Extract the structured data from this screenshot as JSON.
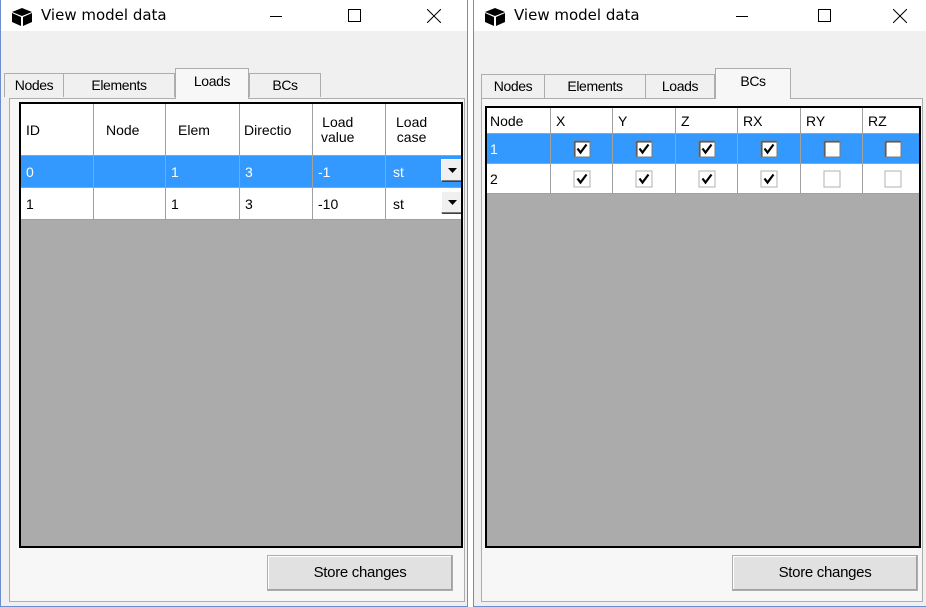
{
  "windows": [
    {
      "title": "View model data",
      "tabs": [
        "Nodes",
        "Elements",
        "Loads",
        "BCs"
      ],
      "active_tab": "Loads",
      "columns": [
        "ID",
        "Node",
        "Elem",
        "Directio",
        "Load value",
        "Load case"
      ],
      "column_lines": {
        "load_value": [
          "Load",
          "value"
        ],
        "load_case": [
          "Load",
          "case"
        ]
      },
      "rows": [
        {
          "id": "0",
          "node": "",
          "elem": "1",
          "direction": "3",
          "load_value": "-1",
          "load_case": "st",
          "selected": true
        },
        {
          "id": "1",
          "node": "",
          "elem": "1",
          "direction": "3",
          "load_value": "-10",
          "load_case": "st",
          "selected": false
        }
      ],
      "store_label": "Store changes"
    },
    {
      "title": "View model data",
      "tabs": [
        "Nodes",
        "Elements",
        "Loads",
        "BCs"
      ],
      "active_tab": "BCs",
      "columns": [
        "Node",
        "X",
        "Y",
        "Z",
        "RX",
        "RY",
        "RZ"
      ],
      "rows": [
        {
          "node": "1",
          "x": true,
          "y": true,
          "z": true,
          "rx": true,
          "ry": false,
          "rz": false,
          "selected": true
        },
        {
          "node": "2",
          "x": true,
          "y": true,
          "z": true,
          "rx": true,
          "ry": false,
          "rz": false,
          "selected": false
        }
      ],
      "store_label": "Store changes"
    }
  ],
  "titlebar_buttons": {
    "minimize": "minimize-icon",
    "maximize": "maximize-icon",
    "close": "close-icon"
  },
  "colors": {
    "selection": "#3399ff",
    "grid_background": "#ababab",
    "window_border": "#6a8fcf"
  }
}
